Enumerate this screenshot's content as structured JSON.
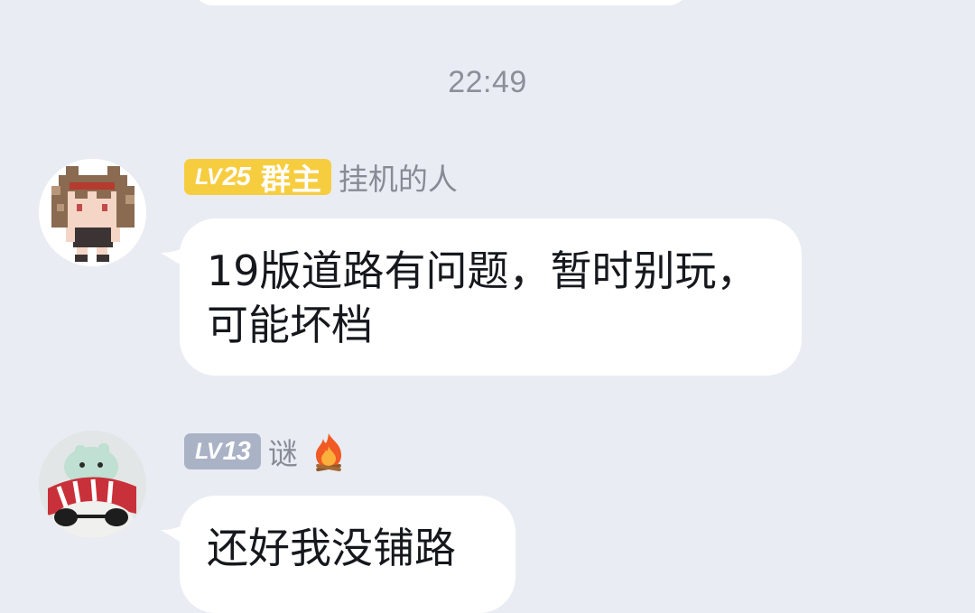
{
  "chat": {
    "timestamp": "22:49",
    "messages": [
      {
        "level_prefix": "LV",
        "level_number": "25",
        "role": "群主",
        "nickname": "挂机的人",
        "text": "19版道路有问题，暂时别玩，可能坏档",
        "avatar_icon": "pixel-character-avatar",
        "badge_color": "#f7cd40"
      },
      {
        "level_prefix": "LV",
        "level_number": "13",
        "nickname": "谜",
        "title_icon": "fire-emoji",
        "text": "还好我没铺路",
        "avatar_icon": "plush-toy-avatar",
        "badge_color": "#aab2c6"
      }
    ]
  }
}
